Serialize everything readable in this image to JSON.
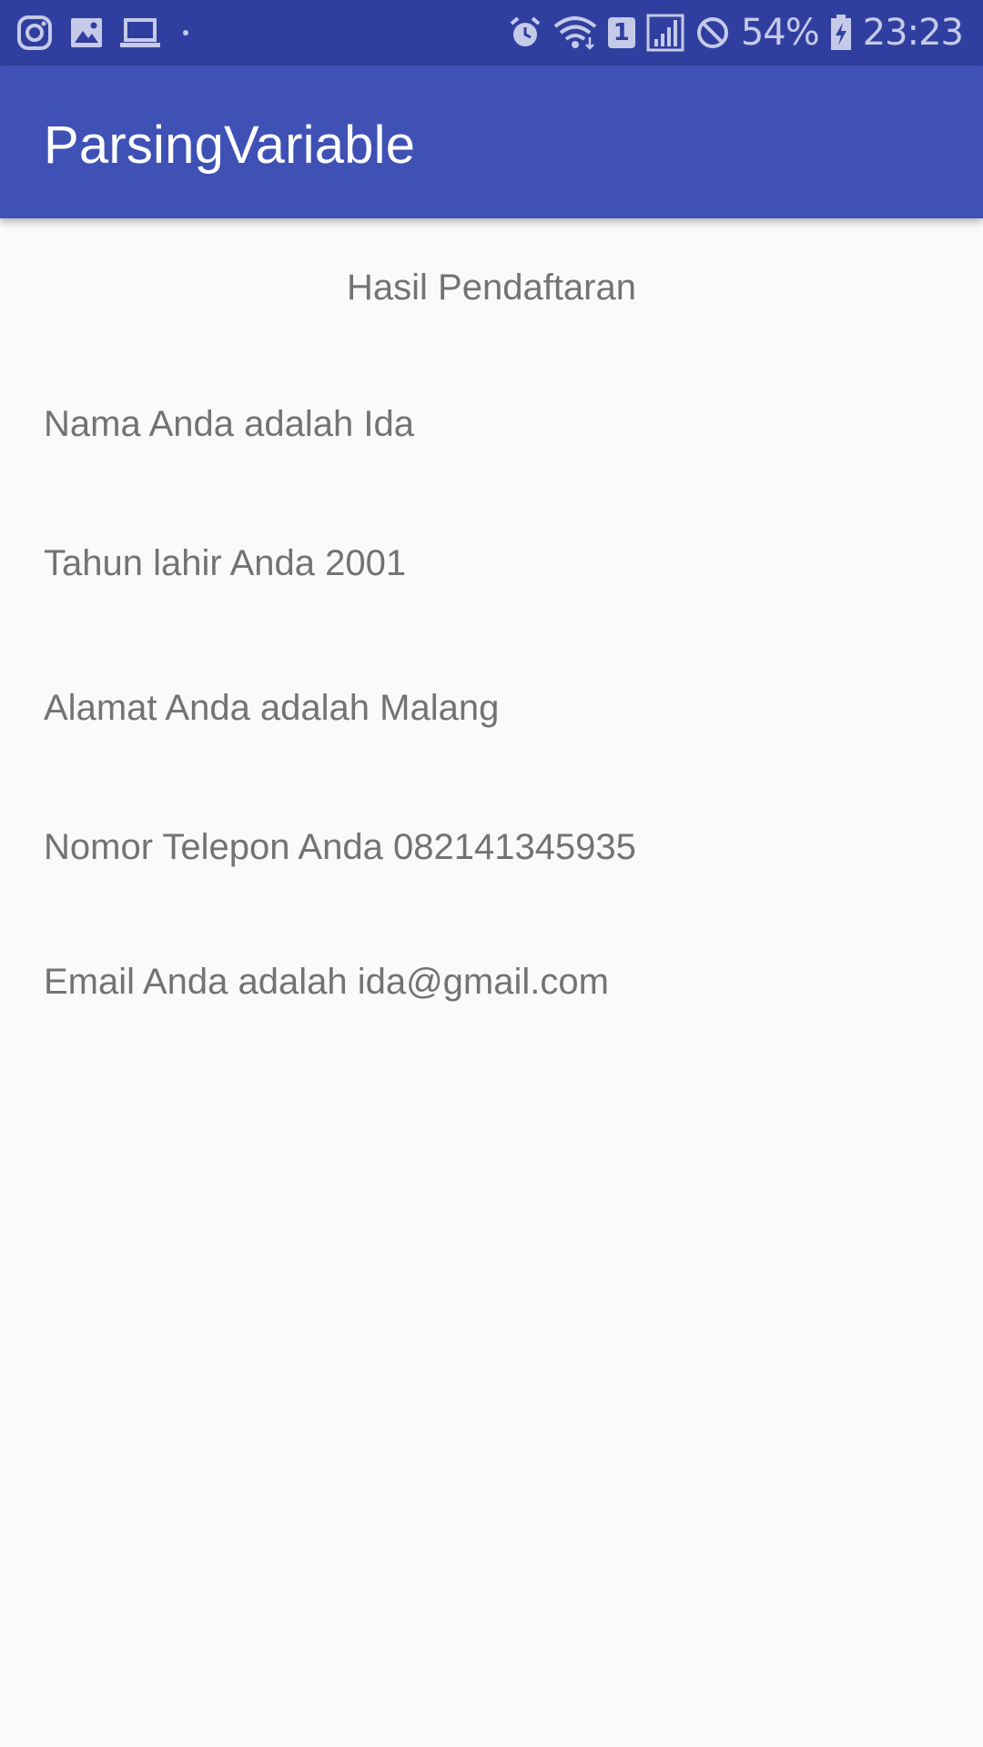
{
  "status_bar": {
    "icons_left": [
      "instagram-icon",
      "gallery-icon",
      "laptop-icon",
      "dot-icon"
    ],
    "icons_right": [
      "alarm-icon",
      "wifi-icon",
      "sim-icon",
      "signal-icon",
      "block-icon",
      "battery-icon"
    ],
    "sim_slot": "1",
    "battery_percent": "54%",
    "time": "23:23"
  },
  "app_bar": {
    "title": "ParsingVariable"
  },
  "result": {
    "heading": "Hasil Pendaftaran",
    "name_line": "Nama Anda adalah Ida",
    "birth_year_line": "Tahun lahir Anda 2001",
    "address_line": "Alamat Anda adalah Malang",
    "phone_line": "Nomor Telepon Anda 082141345935",
    "email_line": "Email Anda adalah ida@gmail.com"
  },
  "colors": {
    "status_bar": "#303f9f",
    "app_bar": "#3f51b5",
    "background": "#fafafa",
    "text": "#737373"
  }
}
